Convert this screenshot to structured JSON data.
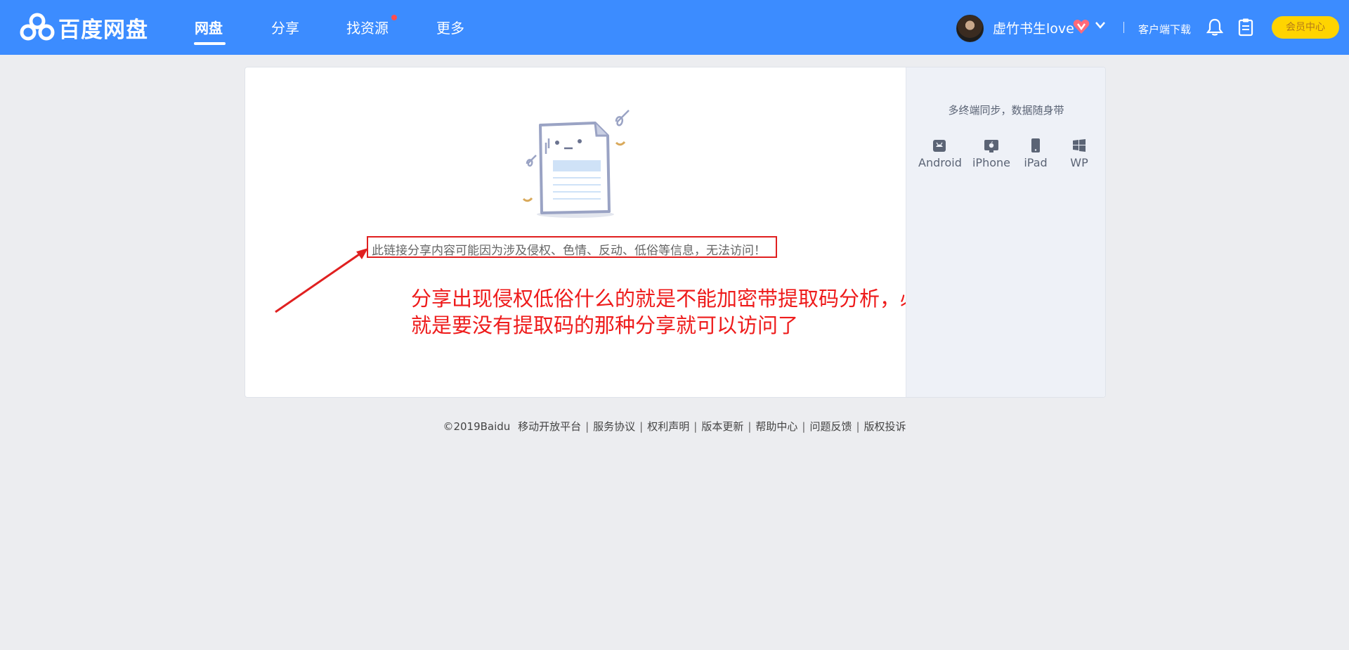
{
  "header": {
    "logo_text": "百度网盘",
    "nav": [
      {
        "label": "网盘"
      },
      {
        "label": "分享"
      },
      {
        "label": "找资源"
      },
      {
        "label": "更多"
      }
    ],
    "username": "虚竹书生love",
    "download": "客户端下载",
    "vip_center": "会员中心",
    "colors": {
      "bar": "#3c8cff",
      "vip_button": "#ffd400",
      "heart": "#ff6a7a"
    }
  },
  "main": {
    "message": "此链接分享内容可能因为涉及侵权、色情、反动、低俗等信息，无法访问！",
    "annotation_line1": "分享出现侵权低俗什么的就是不能加密带提取码分析，必须公开分享才可以",
    "annotation_line2": "就是要没有提取码的那种分享就可以访问了",
    "annotation_color": "#ee1b1b"
  },
  "sidebar": {
    "title": "多终端同步，数据随身带",
    "devices": [
      {
        "label": "Android",
        "icon": "android-icon"
      },
      {
        "label": "iPhone",
        "icon": "apple-icon"
      },
      {
        "label": "iPad",
        "icon": "tablet-icon"
      },
      {
        "label": "WP",
        "icon": "windows-icon"
      }
    ]
  },
  "footer": {
    "copyright": "©2019Baidu",
    "links": [
      "移动开放平台",
      "服务协议",
      "权利声明",
      "版本更新",
      "帮助中心",
      "问题反馈",
      "版权投诉"
    ]
  }
}
